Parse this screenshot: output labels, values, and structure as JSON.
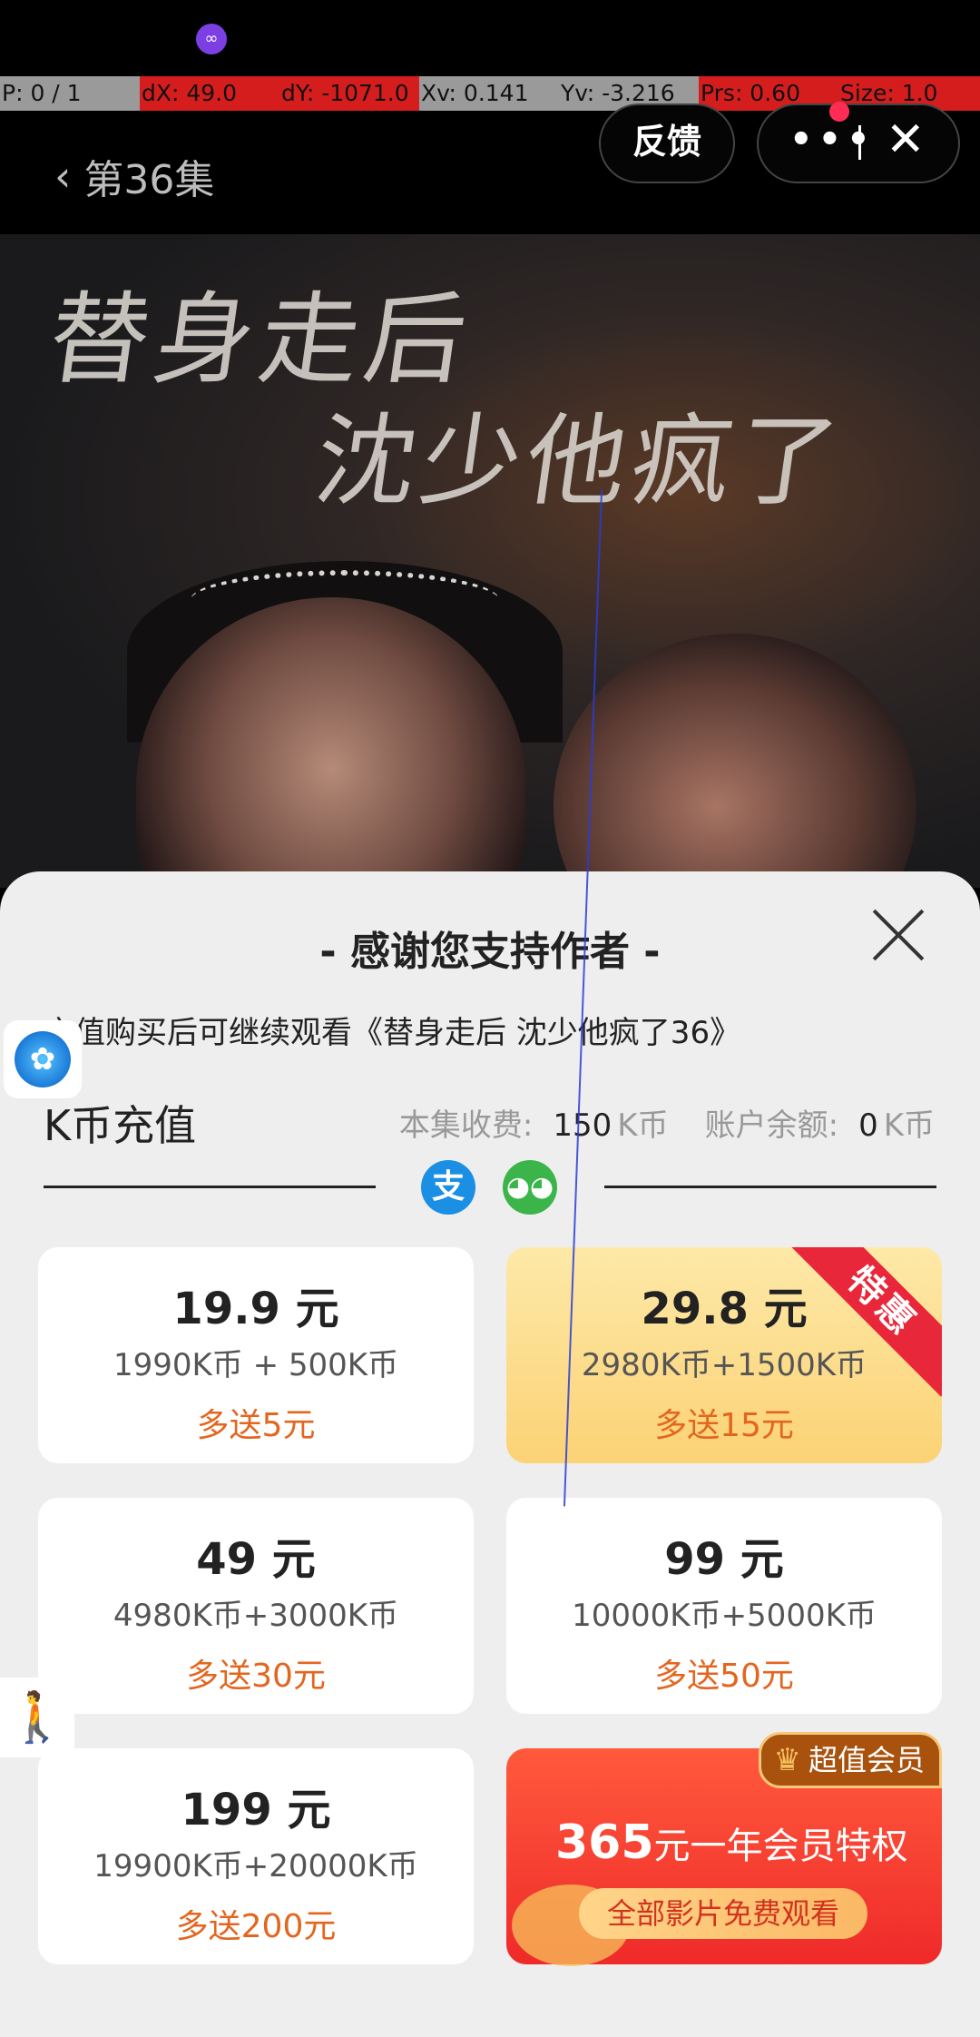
{
  "debug": {
    "p": "P: 0 / 1",
    "dx": "dX: 49.0",
    "dy": "dY: -1071.0",
    "xv": "Xv: 0.141",
    "yv": "Yv: -3.216",
    "prs": "Prs: 0.60",
    "size": "Size: 1.0"
  },
  "header": {
    "back_label": "第36集",
    "feedback_label": "反馈",
    "more_label": "•••",
    "close_label": "✕"
  },
  "poster": {
    "title_line1": "替身走后",
    "title_line2": "沈少他疯了"
  },
  "sheet": {
    "title": "- 感谢您支持作者 -",
    "notice": "充值购买后可继续观看《替身走后 沈少他疯了36》",
    "section_title": "K币充值",
    "fee_label": "本集收费:",
    "fee_value": "150",
    "fee_unit": "K币",
    "balance_label": "账户余额:",
    "balance_value": "0",
    "balance_unit": "K币",
    "alipay_glyph": "支",
    "wechat_glyph": "◕◕"
  },
  "packages": [
    {
      "price": "19.9 元",
      "detail": "1990K币 + 500K币",
      "bonus": "多送5元"
    },
    {
      "price": "29.8 元",
      "detail": "2980K币+1500K币",
      "bonus": "多送15元",
      "ribbon": "特惠"
    },
    {
      "price": "49 元",
      "detail": "4980K币+3000K币",
      "bonus": "多送30元"
    },
    {
      "price": "99 元",
      "detail": "10000K币+5000K币",
      "bonus": "多送50元"
    },
    {
      "price": "199 元",
      "detail": "19900K币+20000K币",
      "bonus": "多送200元"
    }
  ],
  "vip": {
    "badge": "超值会员",
    "amount": "365",
    "main_text": "元一年会员特权",
    "sub_text": "全部影片免费观看"
  },
  "colors": {
    "accent_orange": "#e3661f",
    "ribbon_red": "#e8283a",
    "vip_red": "#ef2a2a",
    "alipay_blue": "#1b8fe3",
    "wechat_green": "#3bb54a"
  }
}
